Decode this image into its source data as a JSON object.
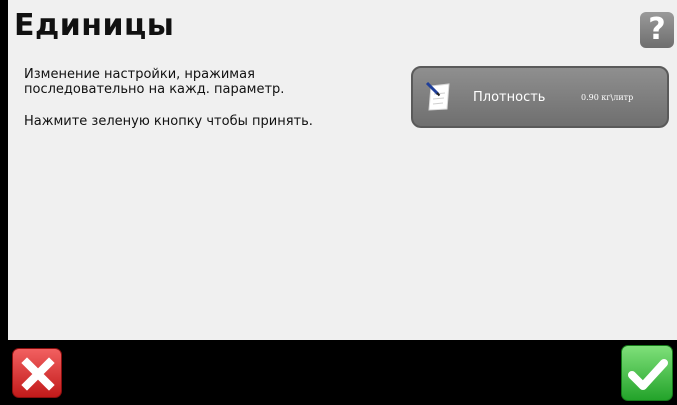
{
  "header": {
    "title": "Единицы",
    "help_label": "?"
  },
  "instructions": {
    "line1": "Изменение настройки, нражимая последовательно на кажд. параметр.",
    "line2": "Нажмите зеленую кнопку чтобы принять."
  },
  "settings": [
    {
      "label": "Плотность",
      "value": "0.90 кг\\литр",
      "icon": "document-pen-icon"
    }
  ],
  "footer": {
    "cancel_icon": "close-icon",
    "confirm_icon": "checkmark-icon"
  },
  "colors": {
    "cancel": "#d32f2f",
    "confirm": "#3cb43c",
    "panel": "#f0f0f0",
    "button": "#7d7d7d"
  }
}
